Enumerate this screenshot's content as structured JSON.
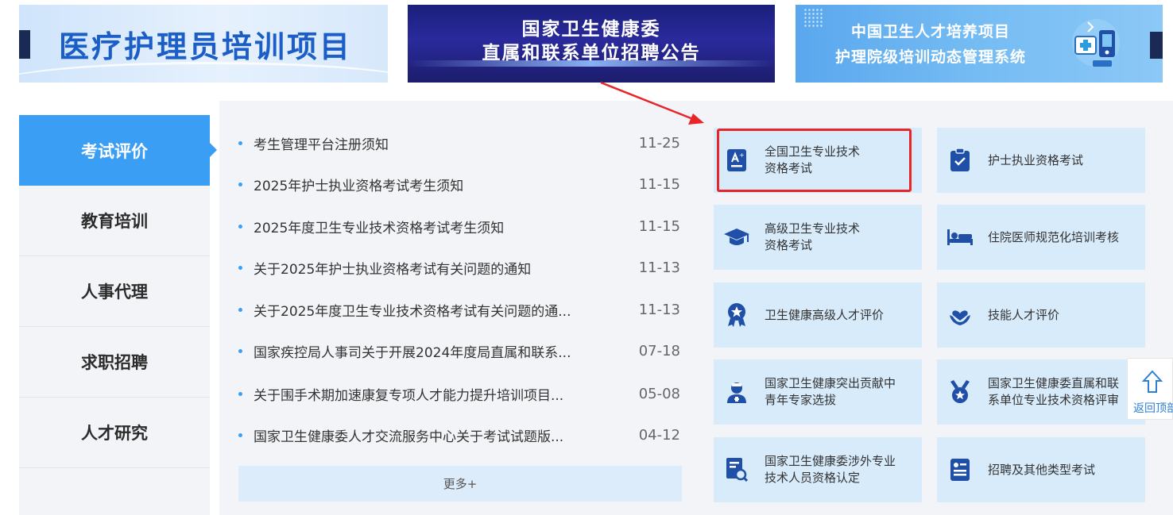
{
  "banners": [
    {
      "lines": [
        "医疗护理员培训项目"
      ]
    },
    {
      "lines": [
        "国家卫生健康委",
        "直属和联系单位招聘公告"
      ]
    },
    {
      "lines": [
        "中国卫生人才培养项目",
        "护理院级培训动态管理系统"
      ]
    }
  ],
  "sidenav": {
    "items": [
      {
        "label": "考试评价",
        "active": true
      },
      {
        "label": "教育培训",
        "active": false
      },
      {
        "label": "人事代理",
        "active": false
      },
      {
        "label": "求职招聘",
        "active": false
      },
      {
        "label": "人才研究",
        "active": false
      }
    ]
  },
  "news": {
    "items": [
      {
        "title": "考生管理平台注册须知",
        "date": "11-25"
      },
      {
        "title": "2025年护士执业资格考试考生须知",
        "date": "11-15"
      },
      {
        "title": "2025年度卫生专业技术资格考试考生须知",
        "date": "11-15"
      },
      {
        "title": "关于2025年护士执业资格考试有关问题的通知",
        "date": "11-13"
      },
      {
        "title": "关于2025年度卫生专业技术资格考试有关问题的通...",
        "date": "11-13"
      },
      {
        "title": "国家疾控局人事司关于开展2024年度局直属和联系...",
        "date": "07-18"
      },
      {
        "title": "关于围手术期加速康复专项人才能力提升培训项目...",
        "date": "05-08"
      },
      {
        "title": "国家卫生健康委人才交流服务中心关于考试试题版...",
        "date": "04-12"
      }
    ],
    "more_label": "更多+"
  },
  "services": {
    "items": [
      {
        "label": "全国卫生专业技术\n资格考试",
        "icon": "certificate-a-icon",
        "highlighted": true
      },
      {
        "label": "护士执业资格考试",
        "icon": "clipboard-check-icon"
      },
      {
        "label": "高级卫生专业技术\n资格考试",
        "icon": "graduation-cap-icon"
      },
      {
        "label": "住院医师规范化培训考核",
        "icon": "hospital-bed-icon"
      },
      {
        "label": "卫生健康高级人才评价",
        "icon": "medal-star-icon"
      },
      {
        "label": "技能人才评价",
        "icon": "heart-hands-icon"
      },
      {
        "label": "国家卫生健康突出贡献中\n青年专家选拔",
        "icon": "doctor-icon"
      },
      {
        "label": "国家卫生健康委直属和联\n系单位专业技术资格评审",
        "icon": "badge-medal-icon"
      },
      {
        "label": "国家卫生健康委涉外专业\n技术人员资格认定",
        "icon": "document-search-icon"
      },
      {
        "label": "招聘及其他类型考试",
        "icon": "id-card-list-icon"
      }
    ]
  },
  "back_to_top": {
    "label": "返回顶部"
  },
  "colors": {
    "accent": "#3a9ef5",
    "tile": "#d7ebfb",
    "highlight": "#e8262a"
  }
}
